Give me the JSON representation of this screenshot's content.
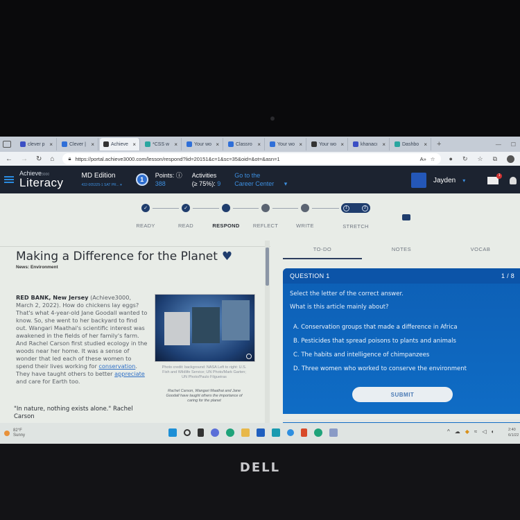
{
  "browser": {
    "tabs": [
      {
        "label": "clever p",
        "color": "#3b4fc4"
      },
      {
        "label": "Clever |",
        "color": "#2f6fd8"
      },
      {
        "label": "Achieve",
        "color": "#333333",
        "active": true
      },
      {
        "label": "*CSS w",
        "color": "#2aa6a0"
      },
      {
        "label": "Your wo",
        "color": "#2f6fd8"
      },
      {
        "label": "Classro",
        "color": "#2f6fd8"
      },
      {
        "label": "Your wo",
        "color": "#2f6fd8"
      },
      {
        "label": "Your wo",
        "color": "#333333"
      },
      {
        "label": "khanacı",
        "color": "#3b4fc4"
      },
      {
        "label": "Dashbo",
        "color": "#2aa6a0"
      }
    ],
    "new_tab": "+",
    "close_glyph": "×",
    "url": "https://portal.achieve3000.com/lesson/respond?lid=20151&c=1&sc=35&oid=&ot=&asn=1",
    "reader_icon": "A»",
    "favorite_icon": "☆"
  },
  "app": {
    "brand_small": "Achieve",
    "brand_sup": "3000",
    "brand_big": "Literacy",
    "edition": "MD Edition",
    "edition_sub": "432-005325-1 SAT PR...",
    "level": "1",
    "points_label": "Points: ⓘ",
    "points_value": "388",
    "activities_label": "Activities",
    "activities_sub": "(≥ 75%):",
    "activities_value": "9",
    "career_line1": "Go to the",
    "career_line2": "Career Center",
    "user_name": "Jayden",
    "mail_badge": "1"
  },
  "steps": [
    {
      "label": "READY",
      "state": "done"
    },
    {
      "label": "READ",
      "state": "done"
    },
    {
      "label": "RESPOND",
      "state": "current"
    },
    {
      "label": "REFLECT",
      "state": "todo"
    },
    {
      "label": "WRITE",
      "state": "todo"
    },
    {
      "label": "STRETCH",
      "state": "todo",
      "items": [
        "1",
        "2"
      ]
    }
  ],
  "article": {
    "title": "Making a Difference for the Planet",
    "category": "News: Environment",
    "dateline": "RED BANK, New Jersey",
    "body_1": " (Achieve3000, March 2, 2022). How do chickens lay eggs? That's what 4-year-old Jane Goodall wanted to know. So, she went to her backyard to find out. Wangari Maathai's scientific interest was awakened in the fields of her family's farm. And Rachel Carson first studied ecology in the woods near her home. It was a sense of wonder that led each of these women to spend their lives working for ",
    "vocab_1": "conservation",
    "body_2": ". They have taught others to better ",
    "vocab_2": "appreciate",
    "body_3": " and care for Earth too.",
    "quote": "\"In nature, nothing exists alone.\" Rachel Carson",
    "photo_credit": "Photo credit: background: NASA Left to right: U.S. Fish and Wildlife Service; UN Photo/Mark Garten; UN Photo/Paulo Filgueiras",
    "photo_caption": "Rachel Carson, Wangari Maathai and Jane Goodall have taught others the importance of caring for the planet"
  },
  "panel": {
    "tabs": [
      "TO-DO",
      "NOTES",
      "VOCAB"
    ],
    "active_tab": "TO-DO",
    "question_label": "QUESTION 1",
    "question_count": "1 / 8",
    "instruction": "Select the letter of the correct answer.",
    "question": "What is this article mainly about?",
    "options": [
      "A. Conservation groups that made a difference in Africa",
      "B. Pesticides that spread poisons to plants and animals",
      "C. The habits and intelligence of chimpanzees",
      "D. Three women who worked to conserve the environment"
    ],
    "submit": "SUBMIT"
  },
  "taskbar": {
    "temp": "82°F",
    "condition": "Sunny",
    "time": "2:40",
    "date": "6/1/22"
  },
  "hardware": {
    "brand": "DELL"
  }
}
